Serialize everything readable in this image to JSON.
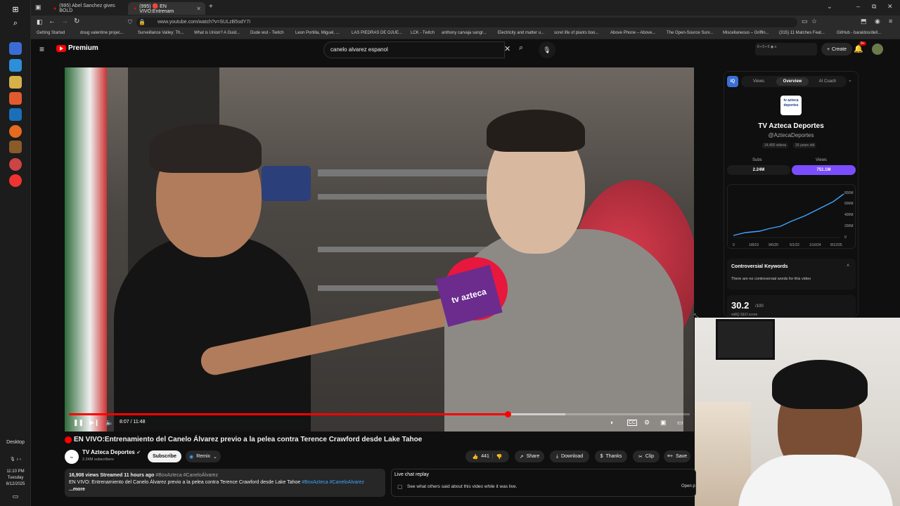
{
  "taskbar": {
    "desktop_label": "Desktop",
    "clock_time": "11:10 PM",
    "clock_day": "Tuesday",
    "clock_date": "8/12/2025"
  },
  "browser": {
    "tabs": [
      {
        "label": "(995) Abel Sanchez gives BOLD"
      },
      {
        "label": "(995) 🔴 EN VIVO:Entrenam"
      }
    ],
    "url": "www.youtube.com/watch?v=SULzB5sdY7I",
    "bookmarks": [
      "Getting Started",
      "doug valentine projec...",
      "Surveillance Valley: Th...",
      "What is Union? A Guid...",
      "Dude wut - Twitch",
      "Leon Portilla, Miguel, ...",
      "LAS PIEDRAS DE OJUE...",
      "LCK - Twitch",
      "anthony carvaja sangr...",
      "Electricity and matter u...",
      "scret life of plants boo...",
      "Above Phone – Above...",
      "The Open-Source Surv...",
      "Miscellaneous – Griffin...",
      "(315) 11 Matches Feat...",
      "GitHub - baraldos/dell..."
    ]
  },
  "youtube": {
    "logo_label": "Premium",
    "search_value": "canelo alvarez espanol",
    "create_label": "Create",
    "notif_count": "9+"
  },
  "player": {
    "time_current": "8:07",
    "time_total": "11:48",
    "progress": 0.707,
    "buffered": 0.8
  },
  "video": {
    "live_dot_color": "#ff0000",
    "title": "EN VIVO:Entrenamiento del Canelo Álvarez previo a la pelea contra Terence Crawford desde Lake Tahoe",
    "channel_name": "TV Azteca Deportes",
    "subscribers": "2.24M subscribers",
    "subscribe_label": "Subscribe",
    "remix_label": "Remix",
    "likes": "441",
    "share_label": "Share",
    "download_label": "Download",
    "thanks_label": "Thanks",
    "clip_label": "Clip",
    "save_label": "Save",
    "desc_stats": "16,908 views  Streamed 11 hours ago",
    "desc_tags": "#BoxAzteca #CaneloÁlvarez",
    "desc_text": "EN VIVO: Entrenamiento del Canelo Álvarez previo a la pelea contra Terence Crawford desde Lake Tahoe",
    "desc_tags2": "#BoxAzteca #CaneloAlvarez",
    "desc_more": "...more",
    "chat_title": "Live chat replay",
    "chat_text": "See what others said about this video while it was live.",
    "chat_open": "Open p"
  },
  "vidiq": {
    "tabs": [
      "Views",
      "Overview",
      "AI Coach"
    ],
    "active_tab": "Overview",
    "logo_text": "tv azteca deportes",
    "channel_name": "TV Azteca Deportes",
    "handle": "@AztecaDeportes",
    "video_count": "14,455 videos",
    "age": "16 years old",
    "subs_label": "Subs",
    "subs_value": "2.24M",
    "views_label": "Views",
    "views_value": "751.1M",
    "accent": "#7b4dff",
    "chart_y_ticks": [
      "800M",
      "600M",
      "400M",
      "200M",
      "0"
    ],
    "chart_x_ticks": [
      "0",
      "1/8/19",
      "9/6/20",
      "5/1/22",
      "1/16/24",
      "8/12/25"
    ],
    "keywords_title": "Controversial Keywords",
    "keywords_text": "There are no controversial words for this video",
    "score_value": "30.2",
    "score_max": "/100",
    "score_label": "vidIQ SEO score"
  },
  "overlay": {
    "mic_flag_text": "tv azteca"
  }
}
